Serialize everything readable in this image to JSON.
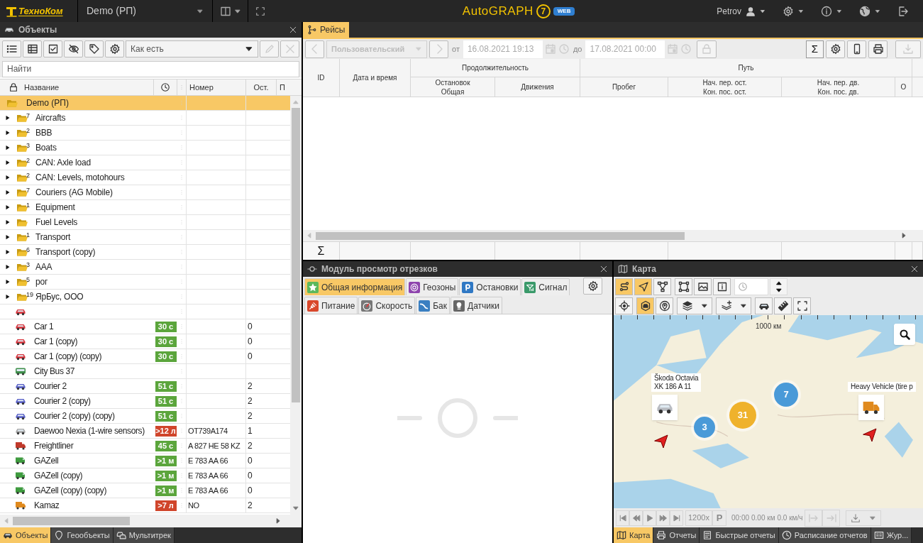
{
  "top_bar": {
    "logo": "ТехноКом",
    "account": "Demo (РП)",
    "app_logo": "AutoGRAPH",
    "app_version": "7",
    "app_badge": "WEB",
    "user": "Petrov"
  },
  "objects_panel": {
    "title": "Объекты",
    "sort": "Как есть",
    "search_placeholder": "Найти",
    "columns": [
      "Название",
      "Номер",
      "Ост.",
      "П"
    ],
    "rows": [
      {
        "kind": "root",
        "name": "Demo (РП)",
        "selected": true
      },
      {
        "kind": "group",
        "name": "Aircrafts",
        "count": "7",
        "expanded": false,
        "selected": false
      },
      {
        "kind": "group",
        "name": "BBB",
        "count": "2",
        "expanded": false,
        "selected": false
      },
      {
        "kind": "group",
        "name": "Boats",
        "count": "3",
        "expanded": false,
        "selected": false
      },
      {
        "kind": "group",
        "name": "CAN: Axle load",
        "count": "2",
        "expanded": false,
        "selected": false
      },
      {
        "kind": "group",
        "name": "CAN: Levels, motohours",
        "count": "2",
        "expanded": false,
        "selected": false
      },
      {
        "kind": "group",
        "name": "Couriers (AG Mobile)",
        "count": "7",
        "expanded": false,
        "selected": false
      },
      {
        "kind": "group",
        "name": "Equipment",
        "count": "1",
        "expanded": false,
        "selected": false
      },
      {
        "kind": "group",
        "name": "Fuel Levels",
        "expanded": false,
        "selected": false
      },
      {
        "kind": "group",
        "name": "Transport",
        "count": "1",
        "expanded": false,
        "selected": false
      },
      {
        "kind": "group",
        "name": "Transport (copy)",
        "count": "6",
        "expanded": false,
        "selected": false
      },
      {
        "kind": "group",
        "name": "AAA",
        "count": "3",
        "expanded": false,
        "selected": false
      },
      {
        "kind": "group",
        "name": "рог",
        "count": "5",
        "expanded": false,
        "selected": false
      },
      {
        "kind": "group",
        "name": "ЯрБус, ООО",
        "count": "19",
        "expanded": false,
        "selected": false
      },
      {
        "kind": "car",
        "color": "#d9363e",
        "selected": false
      },
      {
        "kind": "car",
        "color": "#d9363e",
        "name": "Car 1",
        "badge": {
          "text": "30 с",
          "color": "#5ba53c"
        },
        "remaining": "0",
        "selected": false
      },
      {
        "kind": "car",
        "color": "#d9363e",
        "name": "Car 1 (copy)",
        "badge": {
          "text": "30 с",
          "color": "#5ba53c"
        },
        "remaining": "0",
        "selected": false
      },
      {
        "kind": "car",
        "color": "#d9363e",
        "name": "Car 1 (copy) (copy)",
        "badge": {
          "text": "30 с",
          "color": "#5ba53c"
        },
        "remaining": "0",
        "selected": false
      },
      {
        "kind": "bus",
        "color": "#3f8f4a",
        "name": "City Bus 37",
        "selected": false
      },
      {
        "kind": "car",
        "color": "#5b62c9",
        "name": "Courier 2",
        "badge": {
          "text": "51 с",
          "color": "#5ba53c"
        },
        "remaining": "2",
        "selected": false
      },
      {
        "kind": "car",
        "color": "#5b62c9",
        "name": "Courier 2 (copy)",
        "badge": {
          "text": "51 с",
          "color": "#5ba53c"
        },
        "remaining": "2",
        "selected": false
      },
      {
        "kind": "car",
        "color": "#5b62c9",
        "name": "Courier 2 (copy) (copy)",
        "badge": {
          "text": "51 с",
          "color": "#5ba53c"
        },
        "remaining": "2",
        "selected": false
      },
      {
        "kind": "car",
        "color": "#a8a8a8",
        "name": "Daewoo Nexia (1-wire sensors)",
        "badge": {
          "text": ">12 л",
          "color": "#d0452b"
        },
        "number": "OT739A174",
        "remaining": "1",
        "selected": false
      },
      {
        "kind": "truck",
        "color": "#c0392b",
        "name": "Freightliner",
        "badge": {
          "text": "45 с",
          "color": "#5ba53c"
        },
        "number": "A 827 HE 58 KZ",
        "remaining": "2",
        "selected": false
      },
      {
        "kind": "van",
        "color": "#3f9b3f",
        "name": "GAZell",
        "badge": {
          "text": ">1 м",
          "color": "#5ba53c"
        },
        "number": "E 783 AA 66",
        "remaining": "0",
        "selected": false
      },
      {
        "kind": "van",
        "color": "#3f9b3f",
        "name": "GAZell (copy)",
        "badge": {
          "text": ">1 м",
          "color": "#5ba53c"
        },
        "number": "E 783 AA 66",
        "remaining": "0",
        "selected": false
      },
      {
        "kind": "van",
        "color": "#3f9b3f",
        "name": "GAZell (copy) (copy)",
        "badge": {
          "text": ">1 м",
          "color": "#5ba53c"
        },
        "number": "E 783 AA 66",
        "remaining": "0",
        "selected": false
      },
      {
        "kind": "truck",
        "color": "#e08a1e",
        "name": "Kamaz",
        "badge": {
          "text": ">7 л",
          "color": "#d0452b"
        },
        "number": "NO",
        "remaining": "2",
        "selected": false
      }
    ],
    "tabs": [
      {
        "label": "Объекты",
        "selected": true
      },
      {
        "label": "Геообъекты",
        "selected": false
      },
      {
        "label": "Мультитрек",
        "selected": false
      }
    ]
  },
  "trips_panel": {
    "tab": "Рейсы",
    "period": "Пользовательский",
    "from_label": "от",
    "from": "16.08.2021 19:13",
    "to_label": "до",
    "to": "17.08.2021 00:00",
    "sum_button": "Σ",
    "columns": [
      {
        "label": "ID"
      },
      {
        "label": "Дата и время"
      },
      {
        "label": "Продолжительность",
        "children": [
          {
            "label": "Остановок",
            "label2": "Общая"
          },
          {
            "label": "Движения"
          }
        ]
      },
      {
        "label": "Путь",
        "children": [
          {
            "label": "Пробег"
          },
          {
            "label": "Нач. пер. ост.",
            "label2": "Кон. пос. ост."
          },
          {
            "label": "Нач. пер. дв.",
            "label2": "Кон. пос. дв."
          },
          {
            "label": "О"
          }
        ]
      }
    ],
    "totals_label": "Σ"
  },
  "segments_panel": {
    "title": "Модуль просмотр отрезков",
    "tabs": [
      [
        {
          "label": "Общая информация",
          "color": "#5cb85c",
          "selected": true
        },
        {
          "label": "Геозоны",
          "color": "#8e44ad",
          "selected": false
        },
        {
          "label": "Остановки",
          "color": "#2f78c4",
          "selected": false
        },
        {
          "label": "Сигнал",
          "color": "#3a9a6a",
          "selected": false
        }
      ],
      [
        {
          "label": "Питание",
          "color": "#d9482b",
          "selected": false
        },
        {
          "label": "Скорость",
          "color": "#777777",
          "selected": false
        },
        {
          "label": "Бак",
          "color": "#3a7fc1",
          "selected": false
        },
        {
          "label": "Датчики",
          "color": "#666666",
          "selected": false
        }
      ]
    ]
  },
  "map_panel": {
    "title": "Карта",
    "tools_row1": [
      {
        "selected": true
      },
      {
        "selected": true
      },
      {
        "selected": false
      },
      {
        "selected": false
      },
      {
        "selected": false
      },
      {
        "selected": false
      }
    ],
    "tools_row2": [
      {
        "selected": false
      },
      {
        "selected": true
      },
      {
        "selected": false
      }
    ],
    "scale": "1000 км",
    "clusters": [
      {
        "count": "3",
        "color": "#4a9ad8"
      },
      {
        "count": "31",
        "color": "#efb22c"
      },
      {
        "count": "7",
        "color": "#4a9ad8"
      }
    ],
    "vehicles": [
      {
        "label": "Škoda Octavia",
        "label2": "XK 186 A 11",
        "kind": "car"
      },
      {
        "label": "Heavy Vehicle (tire p",
        "kind": "truck"
      }
    ],
    "player": {
      "speed_factor": "1200x",
      "parking": "P",
      "time": "00:00",
      "distance": "0.00 км",
      "speed": "0.0 км/ч"
    },
    "tabs": [
      {
        "label": "Карта",
        "selected": true
      },
      {
        "label": "Отчеты",
        "selected": false
      },
      {
        "label": "Быстрые отчеты",
        "selected": false
      },
      {
        "label": "Расписание отчетов",
        "selected": false
      },
      {
        "label": "Жур...",
        "selected": false
      }
    ]
  }
}
